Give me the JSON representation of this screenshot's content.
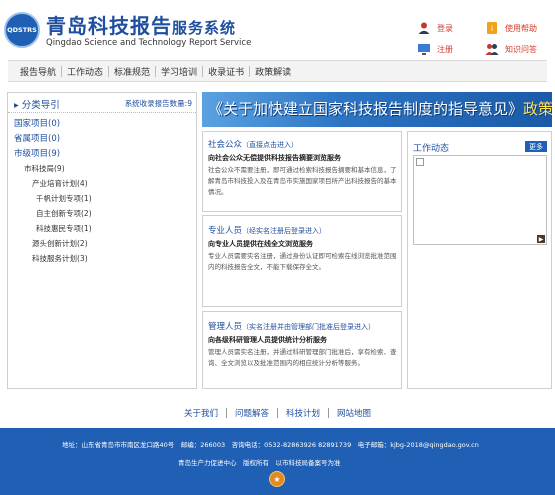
{
  "header": {
    "logo_text": "QDSTRS",
    "title_main": "青岛科技报告",
    "title_suffix": "服务系统",
    "subtitle": "Qingdao Science and Technology Report Service",
    "buttons": [
      {
        "label": "登录",
        "icon": "user-icon"
      },
      {
        "label": "使用帮助",
        "icon": "help-icon"
      },
      {
        "label": "注册",
        "icon": "monitor-icon"
      },
      {
        "label": "知识问答",
        "icon": "users-icon"
      }
    ]
  },
  "nav": {
    "items": [
      "报告导航",
      "工作动态",
      "标准规范",
      "学习培训",
      "收录证书",
      "政策解读"
    ]
  },
  "sidebar": {
    "title": "▸ 分类导引",
    "count_label": "系统收录报告数量:9",
    "items": [
      {
        "label": "国家项目(0)",
        "level": 1
      },
      {
        "label": "省属项目(0)",
        "level": 1
      },
      {
        "label": "市级项目(9)",
        "level": 1
      },
      {
        "label": "市科技局(9)",
        "level": 2
      },
      {
        "label": "产业培育计划(4)",
        "level": 3
      },
      {
        "label": "千帆计划专项(1)",
        "level": 4
      },
      {
        "label": "自主创新专项(2)",
        "level": 4
      },
      {
        "label": "科技惠民专项(1)",
        "level": 4
      },
      {
        "label": "源头创新计划(2)",
        "level": 3
      },
      {
        "label": "科技服务计划(3)",
        "level": 3
      }
    ]
  },
  "banner": {
    "text_main": "《关于加快建立国家科技报告制度的指导意见》",
    "text_highlight": "政策解读"
  },
  "panels": [
    {
      "title": "社会公众",
      "title_note": "（直接点击进入）",
      "subtitle": "向社会公众无偿提供科技报告摘要浏览服务",
      "body": "社会公众不需要注册，即可通过检索科技报告摘要和基本信息，了解青岛市科技投入及在青岛市实施国家项目所产出科技报告的基本情况。"
    },
    {
      "title": "专业人员",
      "title_note": "（经实名注册后登录进入）",
      "subtitle": "向专业人员提供在线全文浏览服务",
      "body": "专业人员需要实名注册，通过身份认证即可检索在线浏览批准范围内的科技报告全文，不能下载保存全文。"
    },
    {
      "title": "管理人员",
      "title_note": "（实名注册并由管理部门批准后登录进入）",
      "subtitle": "向各级科研管理人员提供统计分析服务",
      "body": "管理人员需实名注册，并通过科研管理部门批准后，享有检索、查询、全文浏览以及批准范围内的相应统计分析等服务。"
    }
  ],
  "news": {
    "title": "工作动态",
    "more_label": "更多"
  },
  "footer_links": [
    "关于我们",
    "问题解答",
    "科技计划",
    "网站地图"
  ],
  "footer": {
    "address": "地址：山东省青岛市市南区龙口路40号　邮编：266003　咨询电话：0532-82863926 82891739　电子邮箱：kjbg-2018@qingdao.gov.cn",
    "copyright": "青岛生产力促进中心　版权所有　以市科技局备案号为准"
  },
  "colors": {
    "brand_blue": "#1f5fb4",
    "link_blue": "#1f4f9f",
    "accent_red": "#d23b2b",
    "highlight_yellow": "#ffe25a"
  }
}
